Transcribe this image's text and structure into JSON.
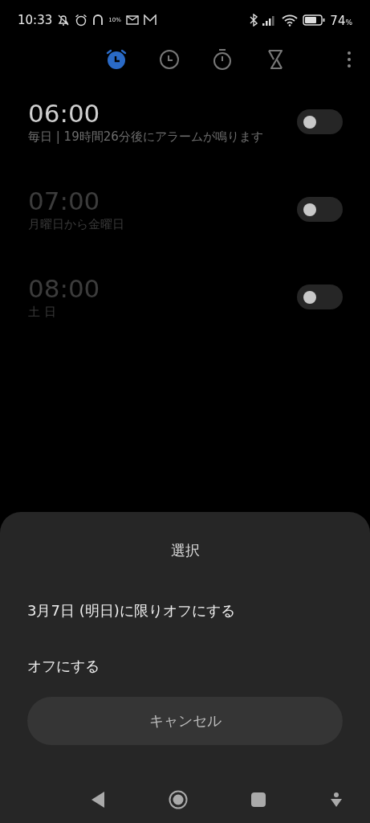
{
  "status_bar": {
    "time": "10:33",
    "storage_label": "10%",
    "battery": "74",
    "battery_unit": "%"
  },
  "tabs": [
    {
      "kind": "alarm",
      "selected": true
    },
    {
      "kind": "clock",
      "selected": false
    },
    {
      "kind": "stopwatch",
      "selected": false
    },
    {
      "kind": "timer",
      "selected": false
    }
  ],
  "alarms": [
    {
      "time": "06:00",
      "repeat": "毎日 | 19時間26分後にアラームが鳴ります",
      "highlighted": true,
      "on": false
    },
    {
      "time": "07:00",
      "repeat": "月曜日から金曜日",
      "highlighted": false,
      "on": false
    },
    {
      "time": "08:00",
      "repeat": "土 日",
      "highlighted": false,
      "on": false
    }
  ],
  "sheet": {
    "title": "選択",
    "options": [
      "3月7日 (明日)に限りオフにする",
      "オフにする"
    ],
    "cancel": "キャンセル"
  }
}
